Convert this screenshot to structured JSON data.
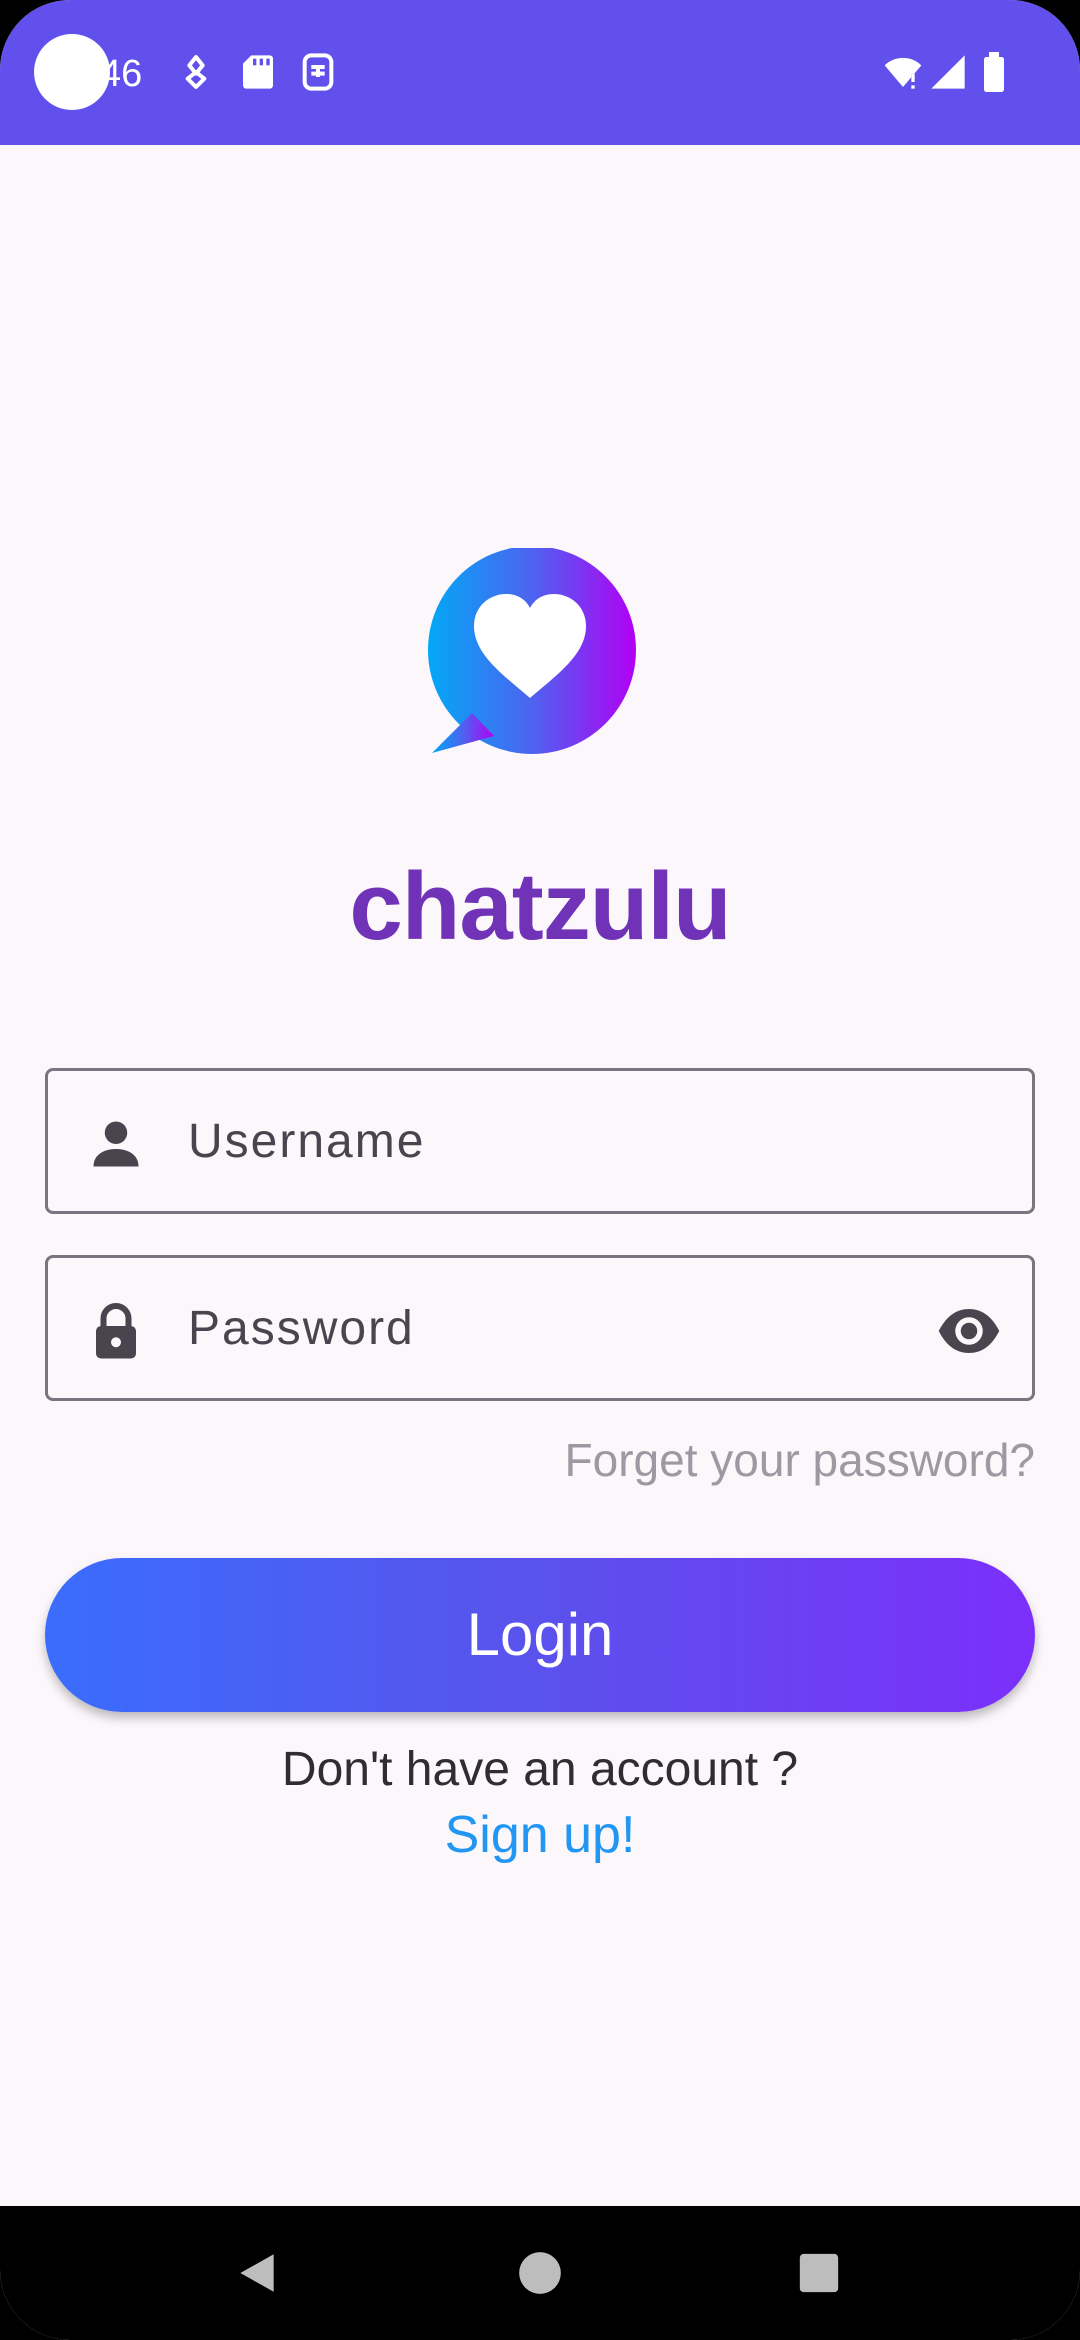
{
  "status_bar": {
    "time": "46",
    "icons": [
      "shape-icon",
      "sd-card-icon",
      "sim-icon",
      "wifi-icon",
      "signal-icon",
      "battery-icon"
    ],
    "background": "#6150ec"
  },
  "app": {
    "name": "chatzulu",
    "logo_icon": "chat-bubble-heart-icon",
    "brand_color": "#7032b7"
  },
  "login_form": {
    "username": {
      "placeholder": "Username",
      "value": "",
      "icon": "person-icon"
    },
    "password": {
      "placeholder": "Password",
      "value": "",
      "icon": "lock-icon",
      "toggle_icon": "eye-icon"
    },
    "forgot_password_label": "Forget your password?",
    "login_label": "Login",
    "no_account_text": "Don't have an account ?",
    "signup_label": "Sign up!",
    "signup_color": "#2196f3"
  },
  "nav_bar": {
    "buttons": [
      "back-icon",
      "home-icon",
      "recents-icon"
    ]
  }
}
